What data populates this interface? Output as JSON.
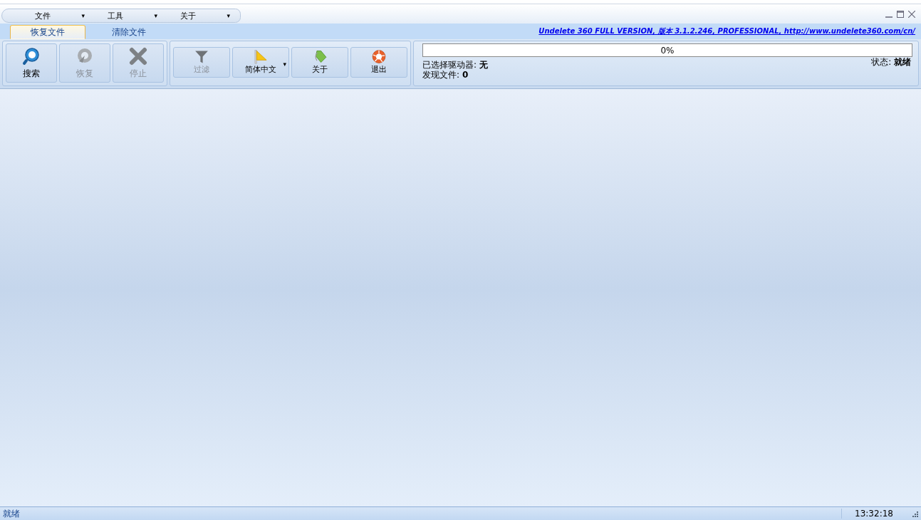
{
  "menu": [
    {
      "label": "文件",
      "arrow": "▾"
    },
    {
      "label": "工具",
      "arrow": "▾"
    },
    {
      "label": "关于",
      "arrow": "▾"
    }
  ],
  "tabs": [
    {
      "label": "恢复文件",
      "selected": true
    },
    {
      "label": "清除文件",
      "selected": false
    }
  ],
  "version_link": "Undelete 360 FULL VERSION, 版本 3.1.2.246, PROFESSIONAL, http://www.undelete360.com/cn/",
  "toolbar_groups": [
    [
      {
        "kind": "search",
        "label": "搜索",
        "disabled": false
      },
      {
        "kind": "recover",
        "label": "恢复",
        "disabled": true
      },
      {
        "kind": "stop",
        "label": "停止",
        "disabled": true
      }
    ],
    [
      {
        "kind": "filter",
        "label": "过滤",
        "disabled": true
      },
      {
        "kind": "language",
        "label": "简体中文",
        "disabled": false,
        "arrow": "▾"
      },
      {
        "kind": "about",
        "label": "关于",
        "disabled": false
      },
      {
        "kind": "exit",
        "label": "退出",
        "disabled": false
      }
    ]
  ],
  "progress": {
    "level": 0,
    "reading": "0%"
  },
  "info": {
    "drive_label": "已选择驱动器:",
    "drive_value": "无",
    "files_label": "发现文件:",
    "files_value": "0",
    "state_label": "状态:",
    "state_value": "就绪"
  },
  "status_bar": {
    "message": "就绪",
    "time": "13:32:18"
  }
}
